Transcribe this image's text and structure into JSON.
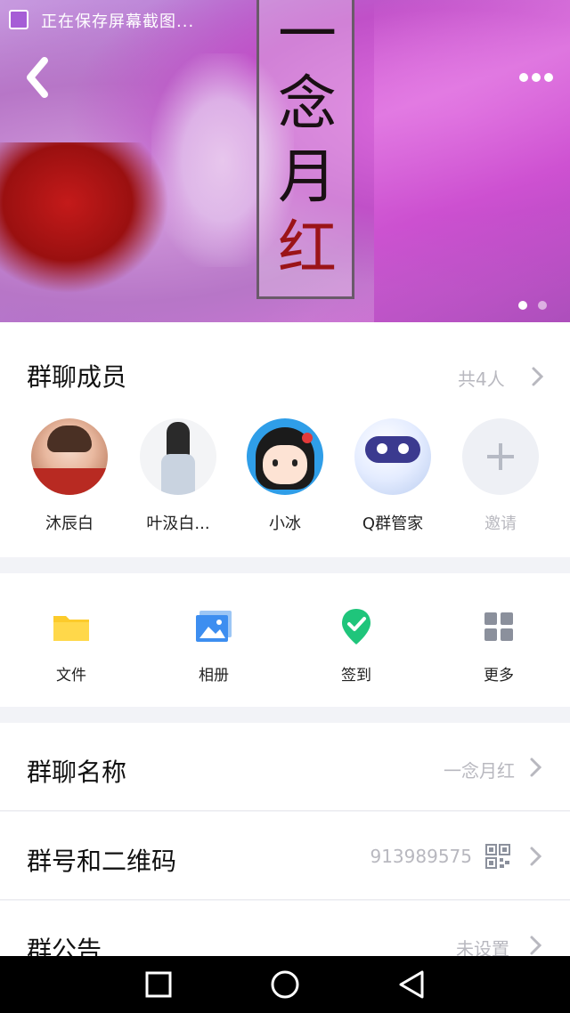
{
  "status_bar": {
    "text": "正在保存屏幕截图..."
  },
  "banner": {
    "title_chars": [
      "一",
      "念",
      "月",
      "红"
    ],
    "page_count": 2,
    "active_page": 1
  },
  "members": {
    "title": "群聊成员",
    "count_text": "共4人",
    "list": [
      {
        "name": "沐辰白"
      },
      {
        "name": "叶汲白..."
      },
      {
        "name": "小冰"
      },
      {
        "name": "Q群管家"
      }
    ],
    "invite_label": "邀请"
  },
  "tools": [
    {
      "label": "文件",
      "icon": "folder-icon"
    },
    {
      "label": "相册",
      "icon": "photo-album-icon"
    },
    {
      "label": "签到",
      "icon": "check-in-icon"
    },
    {
      "label": "更多",
      "icon": "grid-more-icon"
    }
  ],
  "settings": {
    "group_name": {
      "label": "群聊名称",
      "value": "一念月红"
    },
    "group_id": {
      "label": "群号和二维码",
      "value": "913989575"
    },
    "announcement": {
      "label": "群公告",
      "value": "未设置"
    }
  },
  "colors": {
    "accent_blue": "#3d8ef0",
    "check_green": "#1fc57b",
    "folder_yellow": "#fccb2b",
    "muted_text": "#b8b8bf"
  }
}
